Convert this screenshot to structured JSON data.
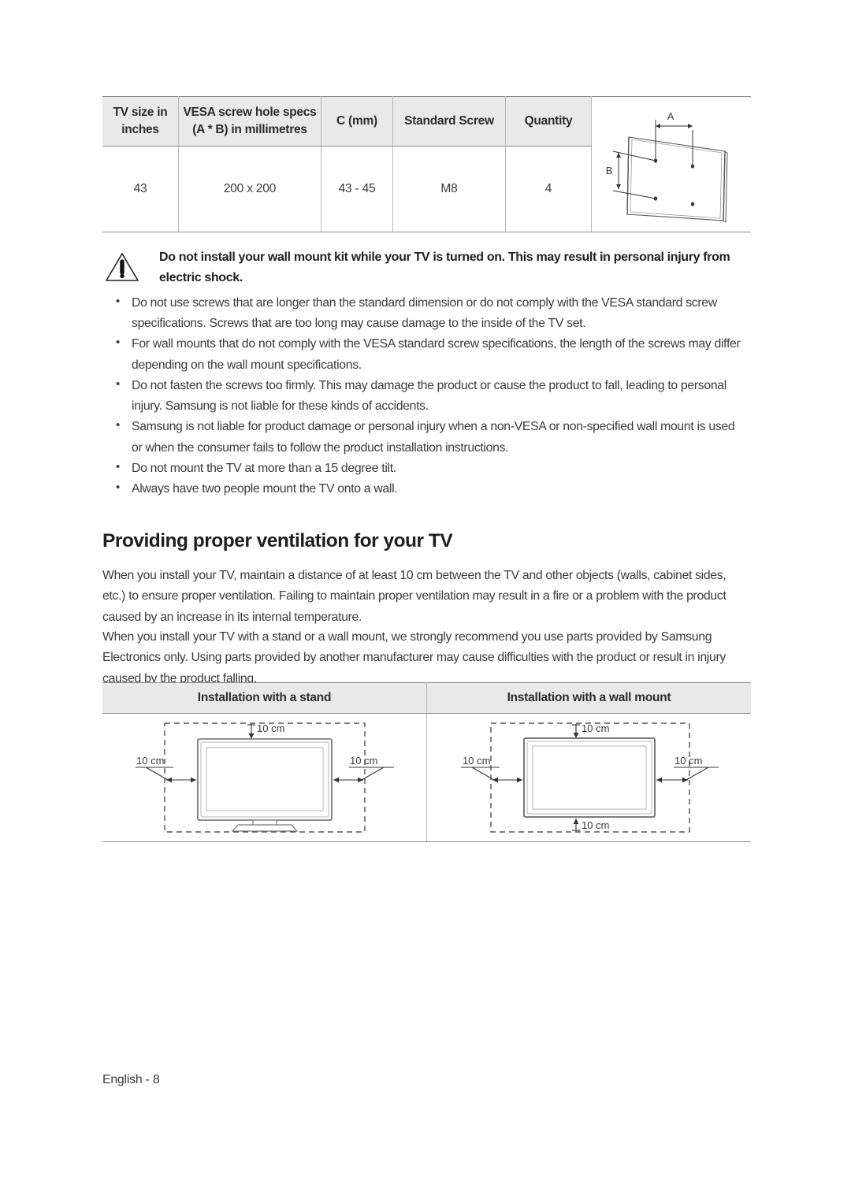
{
  "vesa_table": {
    "headers": [
      "TV size in inches",
      "VESA screw hole specs (A * B) in millimetres",
      "C (mm)",
      "Standard Screw",
      "Quantity"
    ],
    "header_lines": {
      "col1_line1": "TV size in",
      "col1_line2": "inches",
      "col2_line1": "VESA screw hole specs",
      "col2_line2": "(A * B) in millimetres",
      "col3": "C (mm)",
      "col4": "Standard Screw",
      "col5": "Quantity"
    },
    "rows": [
      {
        "tv_size": "43",
        "vesa_spec": "200 x 200",
        "c_mm": "43 - 45",
        "standard_screw": "M8",
        "quantity": "4"
      }
    ],
    "diagram": {
      "label_a": "A",
      "label_b": "B",
      "screw_hole_count": 4
    }
  },
  "warning": {
    "icon": "warning-triangle-icon",
    "text": "Do not install your wall mount kit while your TV is turned on. This may result in personal injury from electric shock."
  },
  "bullets": [
    "Do not use screws that are longer than the standard dimension or do not comply with the VESA standard screw specifications. Screws that are too long may cause damage to the inside of the TV set.",
    "For wall mounts that do not comply with the VESA standard screw specifications, the length of the screws may differ depending on the wall mount specifications.",
    "Do not fasten the screws too firmly. This may damage the product or cause the product to fall, leading to personal injury. Samsung is not liable for these kinds of accidents.",
    "Samsung is not liable for product damage or personal injury when a non-VESA or non-specified wall mount is used or when the consumer fails to follow the product installation instructions.",
    "Do not mount the TV at more than a 15 degree tilt.",
    "Always have two people mount the TV onto a wall."
  ],
  "section": {
    "heading": "Providing proper ventilation for your TV",
    "paragraph_1": "When you install your TV, maintain a distance of at least 10 cm between the TV and other objects (walls, cabinet sides, etc.) to ensure proper ventilation. Failing to maintain proper ventilation may result in a fire or a problem with the product caused by an increase in its internal temperature.",
    "paragraph_2": "When you install your TV with a stand or a wall mount, we strongly recommend you use parts provided by Samsung Electronics only. Using parts provided by another manufacturer may cause difficulties with the product or result in injury caused by the product falling."
  },
  "install_table": {
    "headers": [
      "Installation with a stand",
      "Installation with a wall mount"
    ],
    "stand_diagram": {
      "clearance_top": "10 cm",
      "clearance_left": "10 cm",
      "clearance_right": "10 cm"
    },
    "wall_diagram": {
      "clearance_top": "10 cm",
      "clearance_left": "10 cm",
      "clearance_right": "10 cm",
      "clearance_bottom": "10 cm"
    }
  },
  "footer": {
    "page_label": "English - 8"
  },
  "colors": {
    "header_fill": "#e9e9e9",
    "rule": "#8d8d8d",
    "cell_border": "#b8b8b8",
    "body_text": "#3b3b3b",
    "heading_text": "#1f1f1f"
  }
}
